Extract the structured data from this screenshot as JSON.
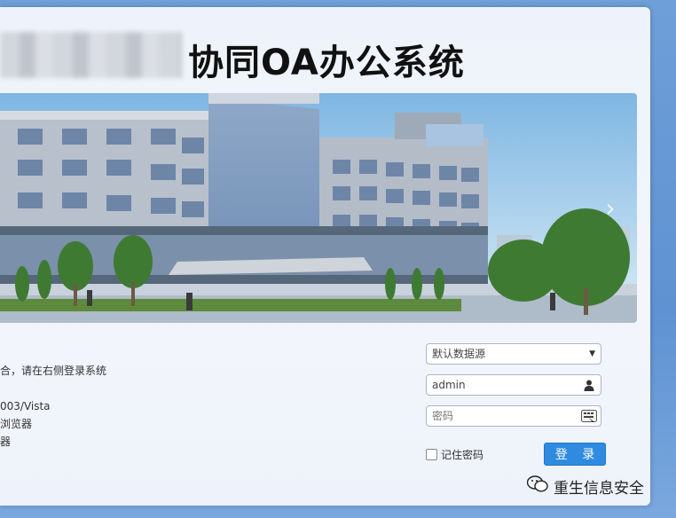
{
  "header": {
    "title": "协同OA办公系统"
  },
  "colors": {
    "accent": "#2f8be0",
    "panel_bg": "#eef3fb",
    "page_bg": "#6f9fd8"
  },
  "banner": {
    "next_icon": "chevron-right-icon",
    "next_glyph": "›"
  },
  "notice": {
    "lines": [
      "合，请在右侧登录系统",
      "",
      "003/Vista",
      "浏览器",
      "器"
    ]
  },
  "login": {
    "datasource": {
      "selected": "默认数据源"
    },
    "username": {
      "value": "admin",
      "icon": "user-icon"
    },
    "password": {
      "placeholder": "密码",
      "icon": "keyboard-icon"
    },
    "remember_label": "记住密码",
    "submit_label": "登 录"
  },
  "watermark": {
    "text": "重生信息安全",
    "icon": "wechat-icon"
  }
}
